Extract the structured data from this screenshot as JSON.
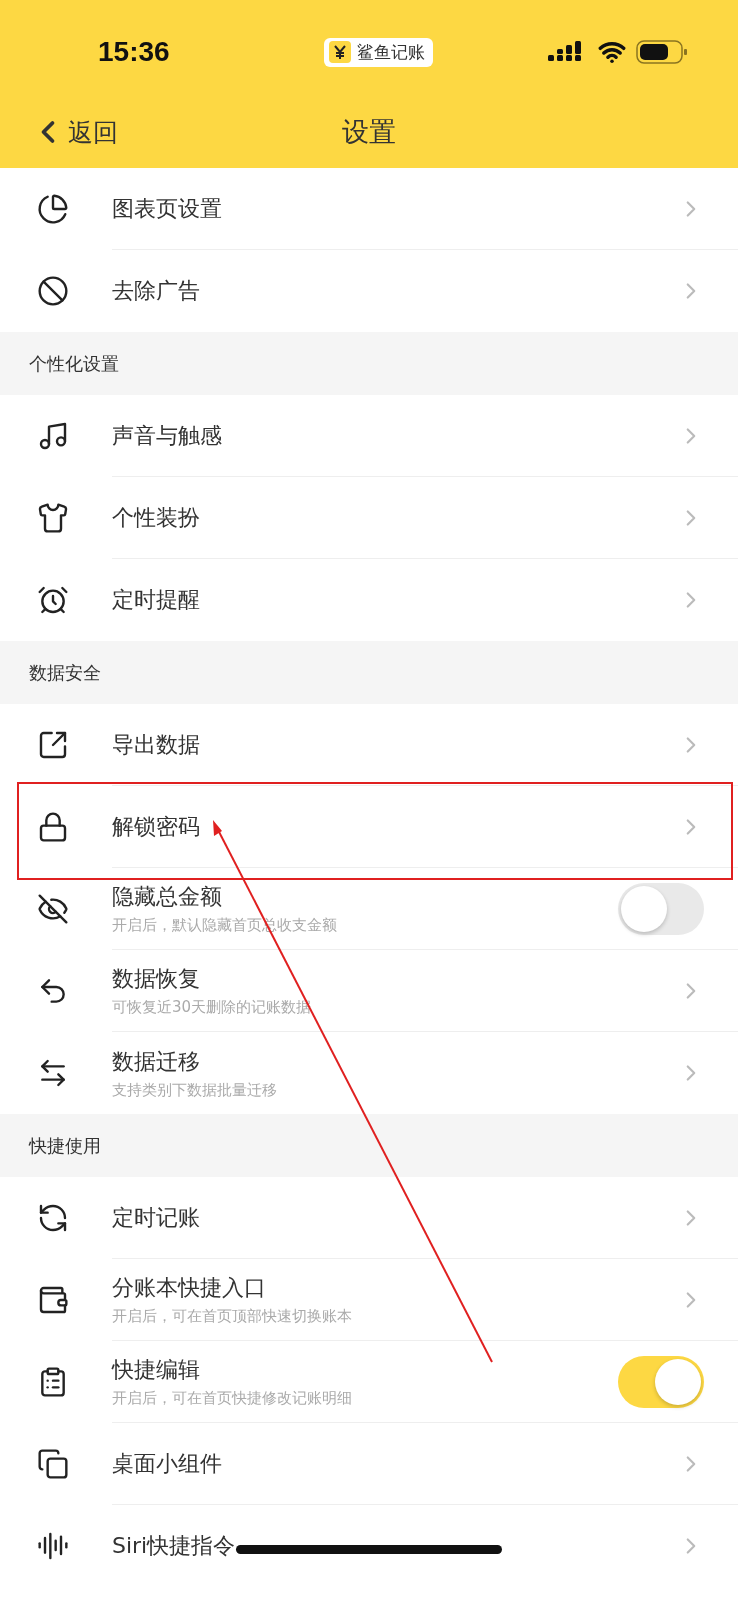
{
  "status_bar": {
    "time": "15:36",
    "app_badge": "鲨鱼记账"
  },
  "nav": {
    "back": "返回",
    "title": "设置"
  },
  "sections": [
    {
      "rows": [
        {
          "kind": "chevron",
          "title": "图表页设置",
          "highlighted": false
        },
        {
          "kind": "chevron",
          "title": "去除广告",
          "highlighted": false
        }
      ]
    },
    {
      "title": "个性化设置",
      "rows": [
        {
          "kind": "chevron",
          "title": "声音与触感",
          "highlighted": false
        },
        {
          "kind": "chevron",
          "title": "个性装扮",
          "highlighted": false
        },
        {
          "kind": "chevron",
          "title": "定时提醒",
          "highlighted": false
        }
      ]
    },
    {
      "title": "数据安全",
      "rows": [
        {
          "kind": "chevron",
          "title": "导出数据",
          "highlighted": false
        },
        {
          "kind": "chevron",
          "title": "解锁密码",
          "highlighted": true
        },
        {
          "kind": "toggle",
          "title": "隐藏总金额",
          "subtitle": "开启后，默认隐藏首页总收支金额",
          "on": false,
          "highlighted": false
        },
        {
          "kind": "chevron",
          "title": "数据恢复",
          "subtitle": "可恢复近30天删除的记账数据",
          "highlighted": false
        },
        {
          "kind": "chevron",
          "title": "数据迁移",
          "subtitle": "支持类别下数据批量迁移",
          "highlighted": false
        }
      ]
    },
    {
      "title": "快捷使用",
      "rows": [
        {
          "kind": "chevron",
          "title": "定时记账",
          "highlighted": false
        },
        {
          "kind": "chevron",
          "title": "分账本快捷入口",
          "subtitle": "开启后，可在首页顶部快速切换账本",
          "highlighted": false
        },
        {
          "kind": "toggle",
          "title": "快捷编辑",
          "subtitle": "开启后，可在首页快捷修改记账明细",
          "on": true,
          "highlighted": false
        },
        {
          "kind": "chevron",
          "title": "桌面小组件",
          "highlighted": false
        },
        {
          "kind": "chevron",
          "title": "Siri快捷指令",
          "highlighted": false
        }
      ]
    }
  ]
}
